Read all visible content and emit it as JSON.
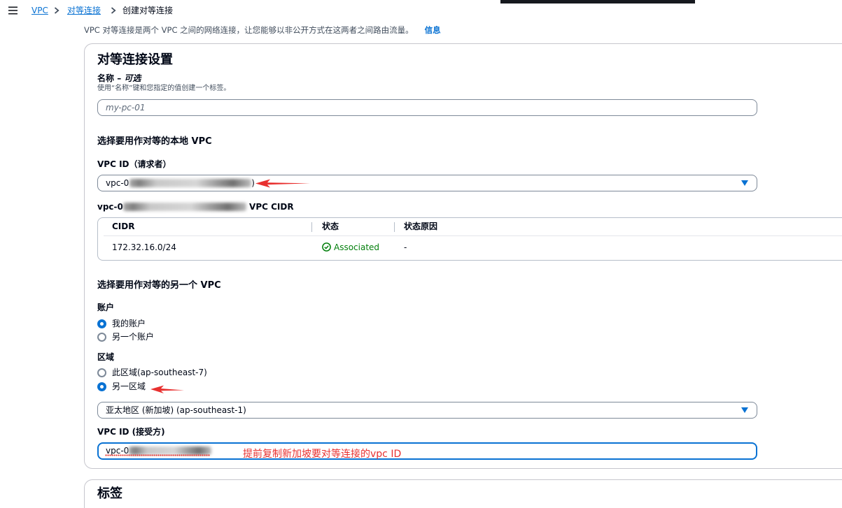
{
  "colors": {
    "accent": "#0972d3",
    "text": "#000716",
    "secondary_text": "#414d5c",
    "success": "#037f0c",
    "annotation": "#e8302f"
  },
  "breadcrumb": {
    "menu_icon": "menu-icon",
    "separator_icon": "chevron-right-icon",
    "links": [
      "VPC",
      "对等连接"
    ],
    "current": "创建对等连接"
  },
  "intro": {
    "text": "VPC 对等连接是两个 VPC 之间的网络连接，让您能够以非公开方式在这两者之间路由流量。",
    "info_link": "信息"
  },
  "settings": {
    "title": "对等连接设置",
    "name": {
      "label": "名称",
      "separator": "–",
      "optional": "可选",
      "description": "使用“名称”键和您指定的值创建一个标签。",
      "placeholder": "my-pc-01",
      "value": ""
    },
    "local_vpc": {
      "heading": "选择要用作对等的本地 VPC",
      "vpc_id_label": "VPC ID（请求者）",
      "vpc_id_value_prefix": "vpc-0",
      "vpc_id_value_suffix": ")",
      "dropdown_icon": "caret-down-icon",
      "cidr_heading_prefix": "vpc-0",
      "cidr_heading_suffix": "VPC CIDR",
      "cidr_table": {
        "columns": [
          "CIDR",
          "状态",
          "状态原因"
        ],
        "rows": [
          {
            "cidr": "172.32.16.0/24",
            "status": "Associated",
            "status_icon": "status-success-icon",
            "status_reason": "-"
          }
        ]
      }
    },
    "peer_vpc": {
      "heading": "选择要用作对等的另一个 VPC",
      "account": {
        "label": "账户",
        "options": [
          {
            "label": "我的账户",
            "selected": true
          },
          {
            "label": "另一个账户",
            "selected": false
          }
        ]
      },
      "region": {
        "label": "区域",
        "options": [
          {
            "label": "此区域(ap-southeast-7)",
            "selected": false
          },
          {
            "label": "另一区域",
            "selected": true
          }
        ],
        "selected_region": "亚太地区 (新加坡) (ap-southeast-1)",
        "dropdown_icon": "caret-down-icon"
      },
      "accepter_vpc_id": {
        "label": "VPC ID (接受方)",
        "value_prefix": "vpc-0"
      }
    }
  },
  "annotation": {
    "note_text": "提前复制新加坡要对等连接的vpc ID"
  },
  "tags": {
    "title": "标签"
  }
}
